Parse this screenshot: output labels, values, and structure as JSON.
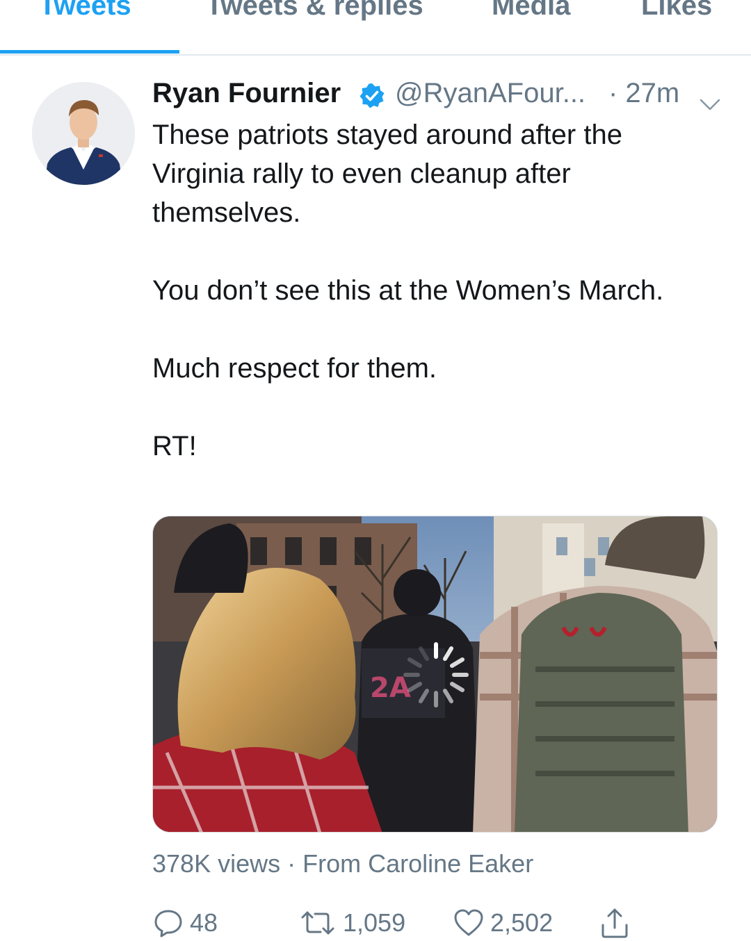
{
  "tabs": [
    {
      "label": "Tweets",
      "active": true
    },
    {
      "label": "Tweets & replies",
      "active": false
    },
    {
      "label": "Media",
      "active": false
    },
    {
      "label": "Likes",
      "active": false
    }
  ],
  "tweet": {
    "display_name": "Ryan Fournier",
    "verified_icon": "verified-badge-icon",
    "handle": "@RyanAFour...",
    "time": "· 27m",
    "caret_icon": "chevron-down-icon",
    "paragraphs": [
      "These patriots stayed around after the Virginia rally to even cleanup after themselves.",
      "You don’t see this at the Women’s March.",
      "Much respect for them.",
      "RT!"
    ],
    "media": {
      "type": "video",
      "loading_icon": "loading-spinner-icon"
    },
    "meta": "378K views · From Caroline Eaker",
    "actions": {
      "replies": "48",
      "retweets": "1,059",
      "likes": "2,502",
      "reply_icon": "reply-icon",
      "retweet_icon": "retweet-icon",
      "like_icon": "heart-icon",
      "share_icon": "share-icon"
    }
  },
  "colors": {
    "accent": "#1da1f2",
    "secondary_text": "#657786",
    "primary_text": "#14171a",
    "divider": "#e1e8ed"
  }
}
